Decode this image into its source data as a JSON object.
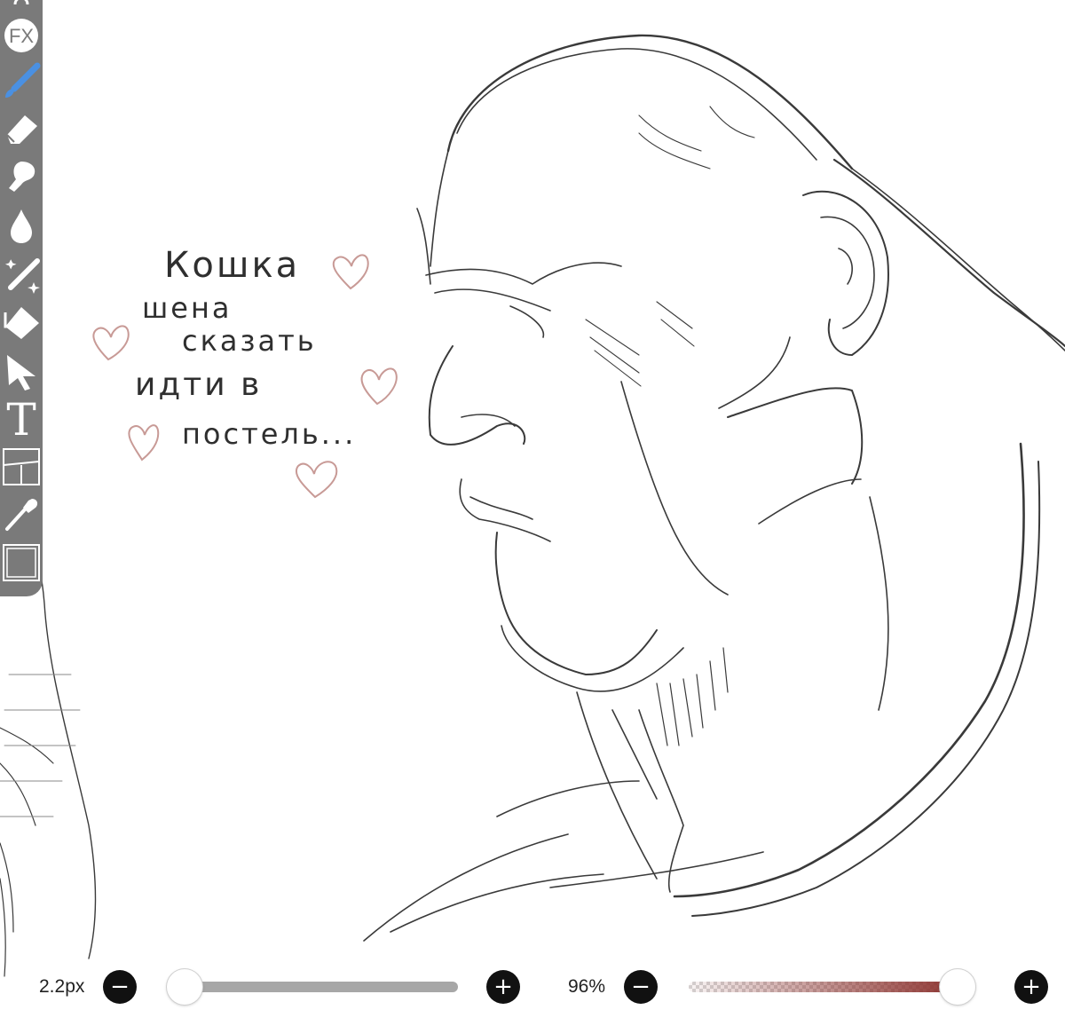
{
  "canvas": {
    "note_lines": [
      "Кошка",
      "шена",
      "сказать",
      "идти в",
      "постель..."
    ],
    "heart_color": "#c89a96",
    "stroke_color": "#3a3a3a"
  },
  "toolbar": {
    "fx_label": "FX",
    "text_tool_label": "T",
    "tools": [
      "undo-icon",
      "fx-icon",
      "brush-icon",
      "eraser-icon",
      "smudge-icon",
      "fill-icon",
      "magic-wand-icon",
      "transform-icon",
      "select-arrow-icon",
      "text-icon",
      "panel-icon",
      "eyedropper-icon",
      "canvas-frame-icon"
    ],
    "active_color": "#4a90e2"
  },
  "brush_size": {
    "value_label": "2.2px",
    "minus_label": "−",
    "plus_label": "+",
    "level": 0.02
  },
  "opacity": {
    "value_label": "96%",
    "minus_label": "−",
    "plus_label": "+",
    "level": 0.96,
    "color": "#8a2e2a"
  }
}
